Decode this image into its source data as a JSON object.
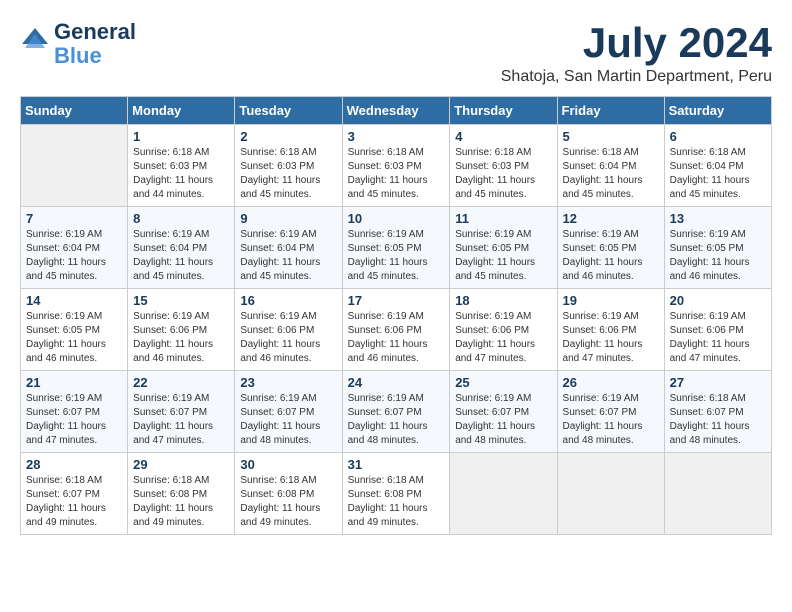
{
  "logo": {
    "line1": "General",
    "line2": "Blue"
  },
  "title": "July 2024",
  "location": "Shatoja, San Martin Department, Peru",
  "days_of_week": [
    "Sunday",
    "Monday",
    "Tuesday",
    "Wednesday",
    "Thursday",
    "Friday",
    "Saturday"
  ],
  "weeks": [
    [
      {
        "day": "",
        "info": ""
      },
      {
        "day": "1",
        "info": "Sunrise: 6:18 AM\nSunset: 6:03 PM\nDaylight: 11 hours\nand 44 minutes."
      },
      {
        "day": "2",
        "info": "Sunrise: 6:18 AM\nSunset: 6:03 PM\nDaylight: 11 hours\nand 45 minutes."
      },
      {
        "day": "3",
        "info": "Sunrise: 6:18 AM\nSunset: 6:03 PM\nDaylight: 11 hours\nand 45 minutes."
      },
      {
        "day": "4",
        "info": "Sunrise: 6:18 AM\nSunset: 6:03 PM\nDaylight: 11 hours\nand 45 minutes."
      },
      {
        "day": "5",
        "info": "Sunrise: 6:18 AM\nSunset: 6:04 PM\nDaylight: 11 hours\nand 45 minutes."
      },
      {
        "day": "6",
        "info": "Sunrise: 6:18 AM\nSunset: 6:04 PM\nDaylight: 11 hours\nand 45 minutes."
      }
    ],
    [
      {
        "day": "7",
        "info": "Sunrise: 6:19 AM\nSunset: 6:04 PM\nDaylight: 11 hours\nand 45 minutes."
      },
      {
        "day": "8",
        "info": "Sunrise: 6:19 AM\nSunset: 6:04 PM\nDaylight: 11 hours\nand 45 minutes."
      },
      {
        "day": "9",
        "info": "Sunrise: 6:19 AM\nSunset: 6:04 PM\nDaylight: 11 hours\nand 45 minutes."
      },
      {
        "day": "10",
        "info": "Sunrise: 6:19 AM\nSunset: 6:05 PM\nDaylight: 11 hours\nand 45 minutes."
      },
      {
        "day": "11",
        "info": "Sunrise: 6:19 AM\nSunset: 6:05 PM\nDaylight: 11 hours\nand 45 minutes."
      },
      {
        "day": "12",
        "info": "Sunrise: 6:19 AM\nSunset: 6:05 PM\nDaylight: 11 hours\nand 46 minutes."
      },
      {
        "day": "13",
        "info": "Sunrise: 6:19 AM\nSunset: 6:05 PM\nDaylight: 11 hours\nand 46 minutes."
      }
    ],
    [
      {
        "day": "14",
        "info": "Sunrise: 6:19 AM\nSunset: 6:05 PM\nDaylight: 11 hours\nand 46 minutes."
      },
      {
        "day": "15",
        "info": "Sunrise: 6:19 AM\nSunset: 6:06 PM\nDaylight: 11 hours\nand 46 minutes."
      },
      {
        "day": "16",
        "info": "Sunrise: 6:19 AM\nSunset: 6:06 PM\nDaylight: 11 hours\nand 46 minutes."
      },
      {
        "day": "17",
        "info": "Sunrise: 6:19 AM\nSunset: 6:06 PM\nDaylight: 11 hours\nand 46 minutes."
      },
      {
        "day": "18",
        "info": "Sunrise: 6:19 AM\nSunset: 6:06 PM\nDaylight: 11 hours\nand 47 minutes."
      },
      {
        "day": "19",
        "info": "Sunrise: 6:19 AM\nSunset: 6:06 PM\nDaylight: 11 hours\nand 47 minutes."
      },
      {
        "day": "20",
        "info": "Sunrise: 6:19 AM\nSunset: 6:06 PM\nDaylight: 11 hours\nand 47 minutes."
      }
    ],
    [
      {
        "day": "21",
        "info": "Sunrise: 6:19 AM\nSunset: 6:07 PM\nDaylight: 11 hours\nand 47 minutes."
      },
      {
        "day": "22",
        "info": "Sunrise: 6:19 AM\nSunset: 6:07 PM\nDaylight: 11 hours\nand 47 minutes."
      },
      {
        "day": "23",
        "info": "Sunrise: 6:19 AM\nSunset: 6:07 PM\nDaylight: 11 hours\nand 48 minutes."
      },
      {
        "day": "24",
        "info": "Sunrise: 6:19 AM\nSunset: 6:07 PM\nDaylight: 11 hours\nand 48 minutes."
      },
      {
        "day": "25",
        "info": "Sunrise: 6:19 AM\nSunset: 6:07 PM\nDaylight: 11 hours\nand 48 minutes."
      },
      {
        "day": "26",
        "info": "Sunrise: 6:19 AM\nSunset: 6:07 PM\nDaylight: 11 hours\nand 48 minutes."
      },
      {
        "day": "27",
        "info": "Sunrise: 6:18 AM\nSunset: 6:07 PM\nDaylight: 11 hours\nand 48 minutes."
      }
    ],
    [
      {
        "day": "28",
        "info": "Sunrise: 6:18 AM\nSunset: 6:07 PM\nDaylight: 11 hours\nand 49 minutes."
      },
      {
        "day": "29",
        "info": "Sunrise: 6:18 AM\nSunset: 6:08 PM\nDaylight: 11 hours\nand 49 minutes."
      },
      {
        "day": "30",
        "info": "Sunrise: 6:18 AM\nSunset: 6:08 PM\nDaylight: 11 hours\nand 49 minutes."
      },
      {
        "day": "31",
        "info": "Sunrise: 6:18 AM\nSunset: 6:08 PM\nDaylight: 11 hours\nand 49 minutes."
      },
      {
        "day": "",
        "info": ""
      },
      {
        "day": "",
        "info": ""
      },
      {
        "day": "",
        "info": ""
      }
    ]
  ]
}
